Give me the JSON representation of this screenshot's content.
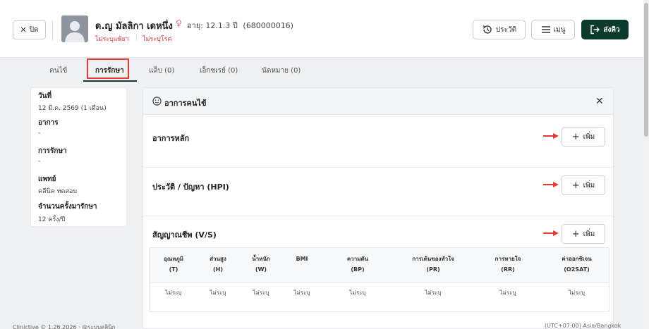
{
  "header": {
    "close_label": "ปิด",
    "patient_name": "ด.ญ มัลลิกา เดหนึ่ง",
    "gender_symbol": "♀",
    "age_text": "อายุ: 12.1.3 ปี",
    "hn": "(680000016)",
    "allergy": "ไม่ระบุแพ้ยา",
    "disease": "ไม่ระบุโรค",
    "history_label": "ประวัติ",
    "menu_label": "เมนู",
    "send_label": "ส่งคิว"
  },
  "tabs": [
    {
      "label": "คนไข้"
    },
    {
      "label": "การรักษา",
      "active": true
    },
    {
      "label": "แล็บ (0)"
    },
    {
      "label": "เอ็กซเรย์ (0)"
    },
    {
      "label": "นัดหมาย (0)"
    }
  ],
  "visit": {
    "date_label": "วันที่",
    "date_value": "12 มี.ค. 2569 (1 เดือน)",
    "symptom_label": "อาการ",
    "symptom_value": "-",
    "treatment_label": "การรักษา",
    "treatment_value": "-",
    "doctor_label": "แพทย์",
    "doctor_value": "คลีนิค ทดสอบ",
    "visits_label": "จำนวนครั้งมารักษา",
    "visits_value": "12 ครั้ง/ปี"
  },
  "symptoms_panel": {
    "title": "อาการคนไข้",
    "add_label": "เพิ่ม",
    "sections": [
      {
        "title": "อาการหลัก"
      },
      {
        "title": "ประวัติ / ปัญหา (HPI)"
      },
      {
        "title": "สัญญาณชีพ (V/S)"
      }
    ],
    "vitals_columns": [
      {
        "line1": "อุณหภูมิ",
        "line2": "(T)",
        "value": "ไม่ระบุ"
      },
      {
        "line1": "ส่วนสูง",
        "line2": "(H)",
        "value": "ไม่ระบุ"
      },
      {
        "line1": "น้ำหนัก",
        "line2": "(W)",
        "value": "ไม่ระบุ"
      },
      {
        "line1": "BMI",
        "line2": "",
        "value": "ไม่ระบุ"
      },
      {
        "line1": "ความดัน",
        "line2": "(BP)",
        "value": "ไม่ระบุ"
      },
      {
        "line1": "การเต้นของหัวใจ",
        "line2": "(PR)",
        "value": "ไม่ระบุ"
      },
      {
        "line1": "การหายใจ",
        "line2": "(RR)",
        "value": "ไม่ระบุ"
      },
      {
        "line1": "ค่าออกซิเจน",
        "line2": "(O2SAT)",
        "value": "ไม่ระบุ"
      }
    ]
  },
  "footer": {
    "left": "Clinictive © 1.26.2026 · @ระบบคลินิก",
    "right": "(UTC+07:00) Asia/Bangkok"
  },
  "colors": {
    "brand": "#0d3b2e",
    "alert": "#d33b3b",
    "highlight": "#e53935"
  }
}
